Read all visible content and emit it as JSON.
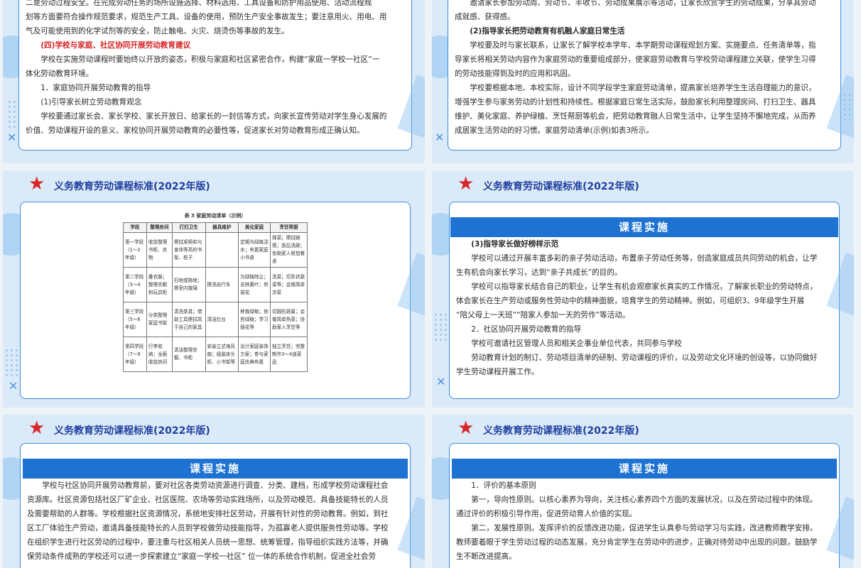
{
  "header_title": "义务教育劳动课程标准(2022年版)",
  "band_title": "课程实施",
  "s1": {
    "lines": [
      {
        "t": "二是劳动过程安全。在完成劳动任务的场所设施选择、材料选用、工具设备和防护用品使用、活动流程规",
        "c": ""
      },
      {
        "t": "划等方面要符合操作规范要求，规范生产工具、设备的使用，预防生产安全事故发生；要注意用火、用电、用",
        "c": ""
      },
      {
        "t": "气及可能使用到的化学试剂等的安全，防止触电、火灾、烧烫伤等事故的发生。",
        "c": ""
      },
      {
        "t": "(四)学校与家庭、社区协同开展劳动教育建议",
        "c": "red ind"
      },
      {
        "t": "学校在实施劳动课程时要始终以开放的姿态，积极与家庭和社区紧密合作，构建“家庭一学校一社区”一",
        "c": "ind"
      },
      {
        "t": "体化劳动教育环境。",
        "c": ""
      },
      {
        "t": "1．家庭协同开展劳动教育的指导",
        "c": "ind"
      },
      {
        "t": "(1)引导家长树立劳动教育观念",
        "c": "ind"
      },
      {
        "t": "学校要通过家长会、家长学校、家长开放日、给家长的一封信等方式，向家长宣传劳动对学生身心发展的",
        "c": "ind"
      },
      {
        "t": "价值、劳动课程开设的意义、家校协同开展劳动教育的必要性等，促进家长对劳动教育形成正确认知。",
        "c": ""
      }
    ]
  },
  "s2": {
    "lines": [
      {
        "t": "邀请家长参加劳动周、劳动节、丰收节、劳动成果展示等活动，让家长欣赏学生的劳动成果，分享其劳动",
        "c": "ind"
      },
      {
        "t": "成就感、获得感。",
        "c": ""
      },
      {
        "t": "(2)指导家长把劳动教育有机融人家庭日常生活",
        "c": "ind bold"
      },
      {
        "t": "学校要及时与家长联系，让家长了解学校本学年、本学期劳动课程规划方案、实施要点、任务清单等，指",
        "c": "ind"
      },
      {
        "t": "导家长将相关劳动内容作为家庭劳动的重要组成部分，使家庭劳动教育与学校劳动课程建立关联，使学生习得",
        "c": ""
      },
      {
        "t": "的劳动技能得到及时的应用和巩固。",
        "c": ""
      },
      {
        "t": "学校要根据本地、本校实际，设计不同学段学生家庭劳动清单，提高家长培养学生生活自理能力的意识，",
        "c": "ind"
      },
      {
        "t": "增强学生参与家务劳动的计划性和持续性。根据家庭日常生活实际，鼓励家长利用整理房间、打扫卫生、器具",
        "c": ""
      },
      {
        "t": "维护、美化家庭、养护绿植、烹饪帮厨等机会，把劳动教育融人日常生活中，让学生坚持不懈地完成，从而养",
        "c": ""
      },
      {
        "t": "成居家生活劳动的好习惯。家庭劳动清单(示例)如表3所示。",
        "c": ""
      }
    ]
  },
  "s3": {
    "caption": "表 3   家庭劳动清单（示例）",
    "headers": [
      "学段",
      "整理房间",
      "打扫卫生",
      "器具维护",
      "美化家庭",
      "烹饪帮厨"
    ],
    "rows": [
      [
        "第一学段（1～2年级）",
        "收拾整理书柜、衣物",
        "擦拭桌椅和与身体等高的书架、柜子",
        "",
        "定期为绿植浇水；布置家庭小书桌",
        "择菜；擦拭碗筷；饭后洗碗；协助家人收拾餐桌"
      ],
      [
        "第二学段（3～4年级）",
        "叠衣服；整理衣橱和玩具柜",
        "扫地或拖地；擦室内玻璃",
        "擦洗自行车",
        "为绿植除尘；去除黄叶；剪窗花",
        "洗菜；切条状蔬菜等；会做简单凉菜"
      ],
      [
        "第三学段（5～6年级）",
        "分类整理家庭书架",
        "清洗茶具；借助工具擦拭高于自己的家具",
        "清洁灶台",
        "移栽绿植；修剪绿植；学习插花等",
        "切圆形蔬果；会做简单热菜；协助家人烹饪等"
      ],
      [
        "第四学段（7～9年级）",
        "行李收纳；全面收拾房间",
        "清洁整理衣橱、书柜",
        "安装立式电风扇；组装床头柜、小书架等",
        "设计家庭装饰方案；参与家庭庆典布置",
        "独立烹饪；完整制作3～4道菜品"
      ]
    ]
  },
  "s4": {
    "lines": [
      {
        "t": "(3)指导家长做好榜样示范",
        "c": "ind bold"
      },
      {
        "t": "学校可以通过开展丰富多彩的亲子劳动活动，布置亲子劳动任务等，创造家庭成员共同劳动的机会，让学",
        "c": "ind"
      },
      {
        "t": "生有机会向家长学习，达到“亲子共成长”的目的。",
        "c": ""
      },
      {
        "t": "学校可以指导家长结合自己的职业，让学生有机会观察家长真实的工作情况，了解家长职业的劳动特点，",
        "c": "ind"
      },
      {
        "t": "体会家长在生产劳动或服务性劳动中的精神面貌，培育学生的劳动精神。例如，可组织3、9年级学生开展",
        "c": ""
      },
      {
        "t": "“陪父母上一天班”“陪家人参加一天的劳作”等活动。",
        "c": ""
      },
      {
        "t": "2．社区协同开展劳动教育的指导",
        "c": "ind"
      },
      {
        "t": "学校可邀请社区管理人员和相关企事业单位代表，共同参与学校",
        "c": "ind"
      },
      {
        "t": "劳动教育计划的制订、劳动项目清单的研制、劳动课程的评价，以及劳动文化环境的创设等，以协同做好",
        "c": "ind"
      },
      {
        "t": "学生劳动课程开展工作。",
        "c": ""
      }
    ]
  },
  "s5": {
    "lines": [
      {
        "t": "学校与社区协同开展劳动教育前，要对社区各类劳动资源进行调查、分类、建档，形成学校劳动课程社会",
        "c": "ind"
      },
      {
        "t": "资源库。社区资源包括社区厂矿企业、社区医院、农场等劳动实践场所，以及劳动模范、具备技能特长的人员",
        "c": ""
      },
      {
        "t": "及需要帮助的人群等。学校根据社区资源情况，系统地安排社区劳动，开展有针对性的劳动教育。例如，到社",
        "c": ""
      },
      {
        "t": "区工厂体验生产劳动，邀请具备技能特长的人员到学校做劳动技能指导，为孤寡老人提供服务性劳动等。学校",
        "c": ""
      },
      {
        "t": "在组织学生进行社区劳动的过程中，要注重与社区相关人员统一思想、统筹管理，指导组织实践方法等，并确",
        "c": ""
      },
      {
        "t": "保劳动条件成熟的学校还可以进一步探索建立“家庭一学校一社区”   位一体的系统合作机制，促进全社会劳",
        "c": ""
      }
    ]
  },
  "s6": {
    "lines": [
      {
        "t": "1．评价的基本原则",
        "c": "ind"
      },
      {
        "t": "第一，导向性原则。以核心素养为导向，关注核心素养四个方面的发展状况，以及在劳动过程中的体现。",
        "c": "ind"
      },
      {
        "t": "通过评价的积极引导作用，促进劳动育人价值的实现。",
        "c": ""
      },
      {
        "t": "第二，发展性原则。发挥评价的反馈改进功能，促进学生认真参与劳动学习与实践，改进教师教学安排。",
        "c": "ind"
      },
      {
        "t": "教师要着眼于学生劳动过程的动态发展，充分肯定学生在劳动中的进步，正确对待劳动中出现的问题，鼓励学",
        "c": ""
      },
      {
        "t": "生不断改进提高。",
        "c": ""
      }
    ]
  }
}
